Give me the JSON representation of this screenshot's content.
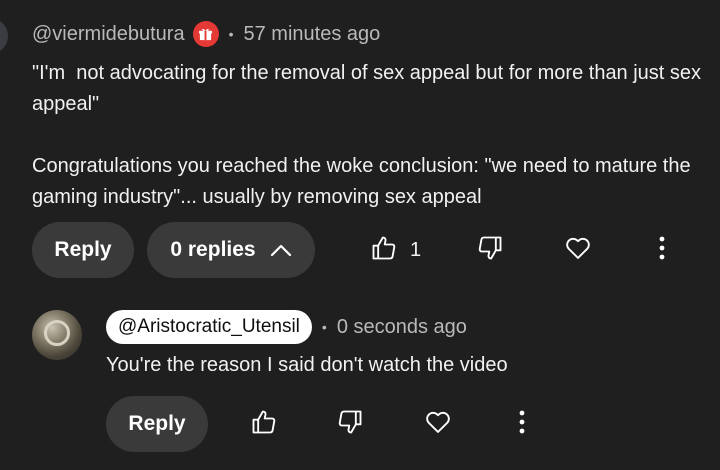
{
  "comment": {
    "handle": "@viermidebutura",
    "badge_icon": "gift-icon",
    "badge_color": "#e53935",
    "separator": "•",
    "timestamp": "57 minutes ago",
    "text": "\"I'm  not advocating for the removal of sex appeal but for more than just sex appeal\"\n\nCongratulations you reached the woke conclusion: \"we need to mature the gaming industry\"... usually by removing sex appeal",
    "actions": {
      "reply_label": "Reply",
      "replies_label": "0 replies",
      "like_count": "1"
    }
  },
  "reply": {
    "mention": "@Aristocratic_Utensil",
    "separator": "•",
    "timestamp": "0 seconds ago",
    "text": "You're the reason I said don't watch the video",
    "actions": {
      "reply_label": "Reply"
    }
  }
}
